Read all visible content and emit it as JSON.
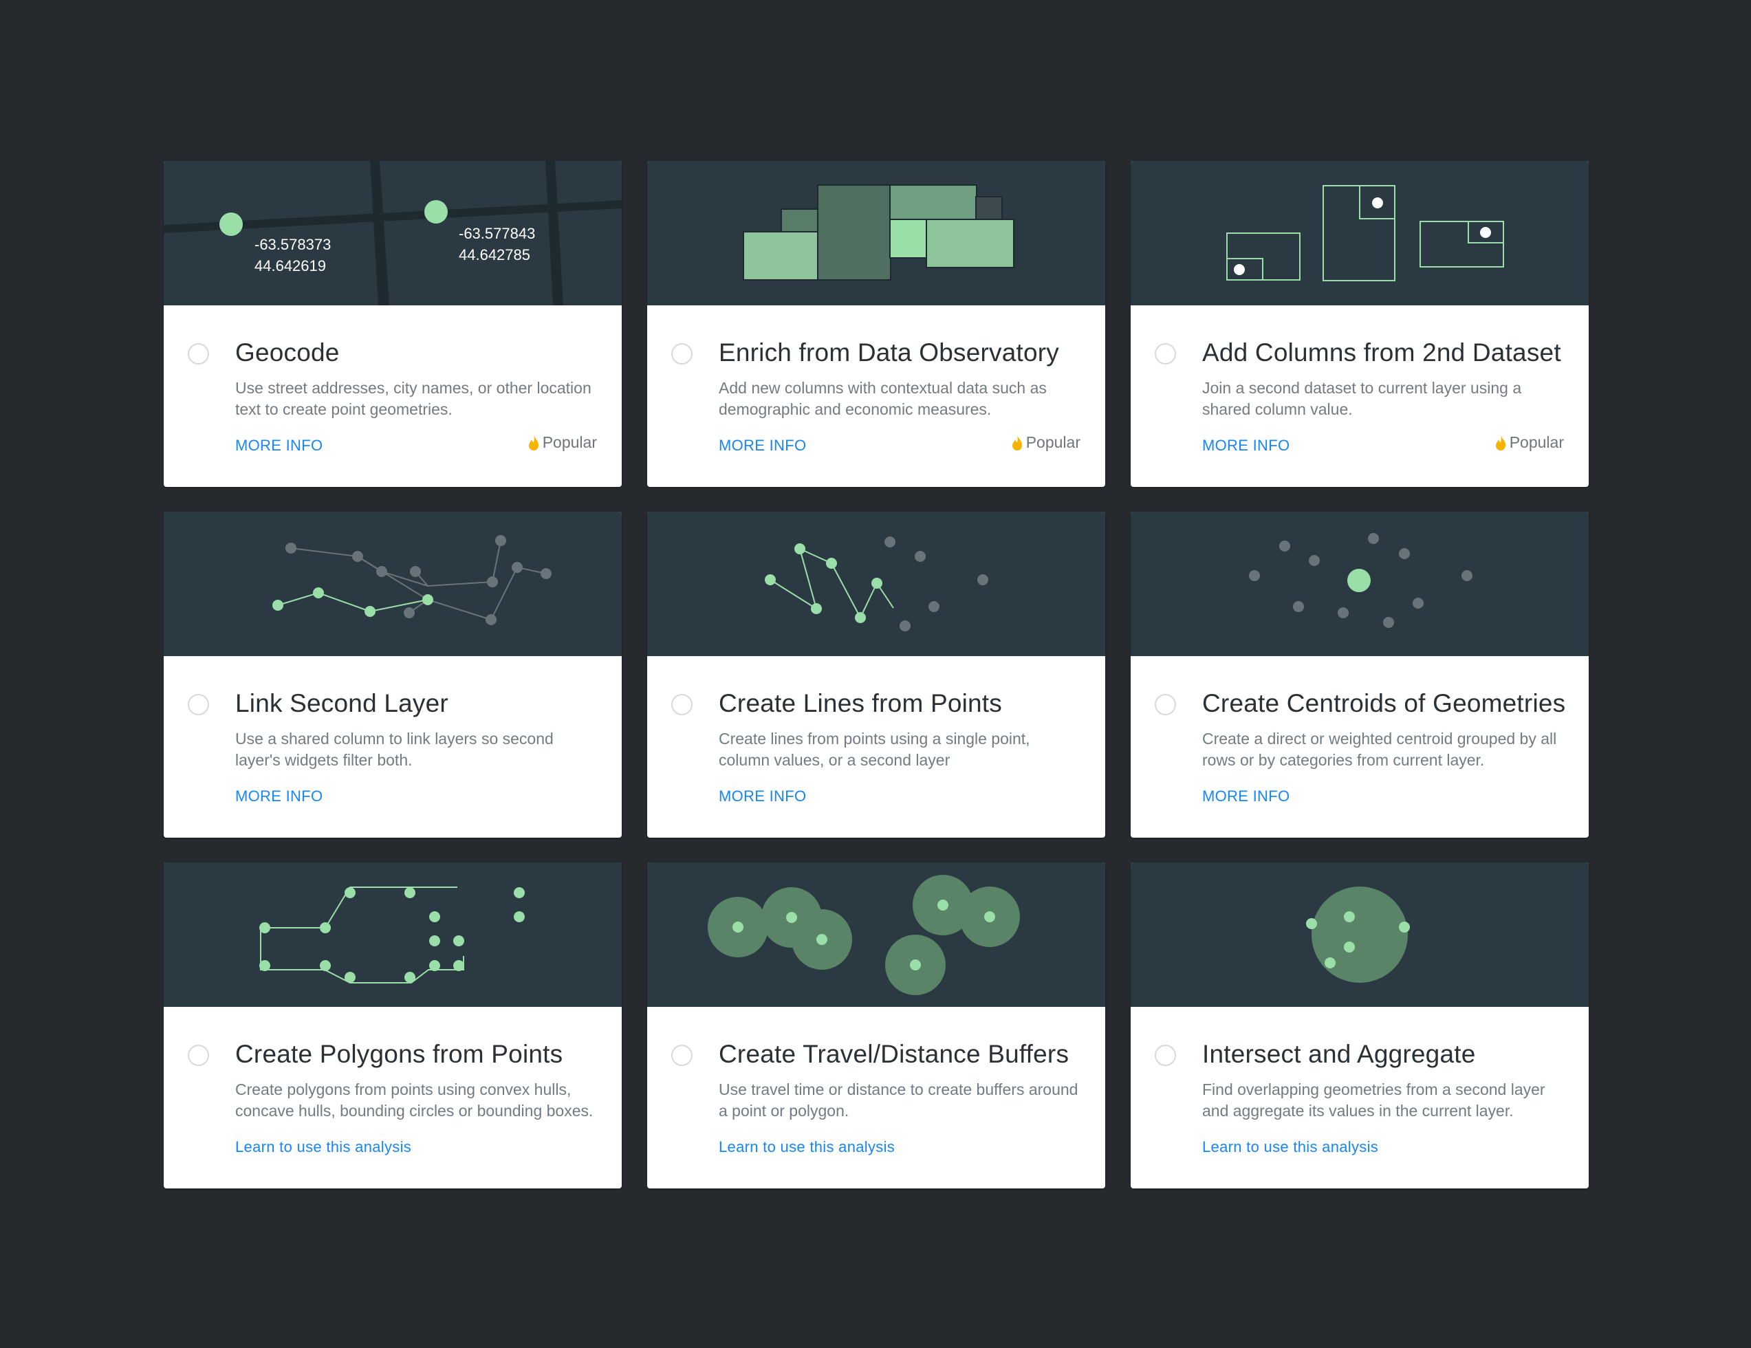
{
  "colors": {
    "background": "#262a2e",
    "illustration": "#2b3a42",
    "accent_green": "#9bdfa8",
    "link_blue": "#1785fb",
    "popular_flame": "#f6b400"
  },
  "cards": [
    {
      "title": "Geocode",
      "description": "Use street addresses, city names, or other location text to create point geometries.",
      "link": "MORE INFO",
      "badge": "Popular",
      "coords": [
        {
          "lng": "-63.578373",
          "lat": "44.642619"
        },
        {
          "lng": "-63.577843",
          "lat": "44.642785"
        }
      ],
      "icon": "map-points-illustration"
    },
    {
      "title": "Enrich from Data Observatory",
      "description": "Add new columns with contextual data such as demographic and economic measures.",
      "link": "MORE INFO",
      "badge": "Popular",
      "icon": "treemap-illustration"
    },
    {
      "title": "Add Columns from 2nd Dataset",
      "description": "Join a second dataset to current layer using a shared column value.",
      "link": "MORE INFO",
      "badge": "Popular",
      "icon": "join-tables-illustration"
    },
    {
      "title": "Link Second Layer",
      "description": "Use a shared column to link layers so second layer's widgets filter both.",
      "link": "MORE INFO",
      "icon": "linked-networks-illustration"
    },
    {
      "title": "Create Lines from Points",
      "description": "Create lines from points using a single point, column values, or a second layer",
      "link": "MORE INFO",
      "icon": "lines-from-points-illustration"
    },
    {
      "title": "Create Centroids of Geometries",
      "description": "Create a direct or weighted centroid grouped by all rows or by categories from current layer.",
      "link": "MORE INFO",
      "icon": "centroid-illustration"
    },
    {
      "title": "Create Polygons from Points",
      "description": "Create polygons from points using convex hulls, concave hulls, bounding circles or bounding boxes.",
      "link": "Learn to use this analysis",
      "icon": "polygons-from-points-illustration"
    },
    {
      "title": "Create Travel/Distance Buffers",
      "description": "Use travel time or distance to create buffers around a point or polygon.",
      "link": "Learn to use this analysis",
      "icon": "buffers-illustration"
    },
    {
      "title": "Intersect and Aggregate",
      "description": "Find overlapping geometries from a second layer and aggregate its values in the current layer.",
      "link": "Learn to use this analysis",
      "icon": "intersect-aggregate-illustration"
    }
  ]
}
